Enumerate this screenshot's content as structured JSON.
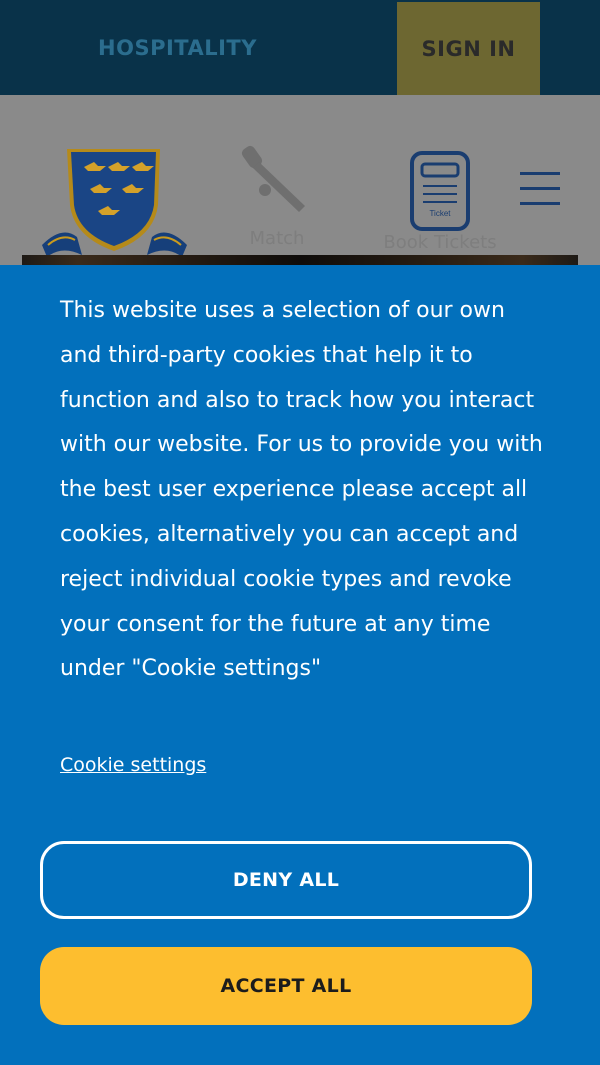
{
  "topbar": {
    "hospitality_label": "HOSPITALITY",
    "signin_label": "SIGN IN"
  },
  "header": {
    "nav": {
      "match_label": "Match",
      "tickets_label": "Book Tickets",
      "ticket_icon_text": "Ticket"
    }
  },
  "cookie_banner": {
    "message": "This website uses a selection of our own and third-party cookies that help it to function and also to track how you interact with our website. For us to provide you with the best user experience please accept all cookies, alternatively you can accept and reject individual cookie types and revoke your consent for the future at any time under \"Cookie settings\"",
    "settings_link": "Cookie settings",
    "deny_label": "DENY ALL",
    "accept_label": "ACCEPT ALL"
  },
  "colors": {
    "banner_blue": "#0270bc",
    "accept_yellow": "#fdbe2f",
    "signin_gold": "#e6a814",
    "topbar_navy": "#093249"
  },
  "icons": [
    "club-crest-icon",
    "cricket-bat-icon",
    "ticket-icon",
    "hamburger-menu-icon"
  ]
}
